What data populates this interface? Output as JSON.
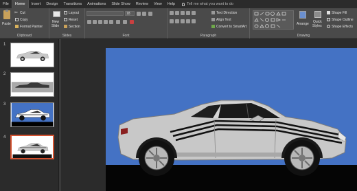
{
  "ribbon_tabs": [
    "File",
    "Home",
    "Insert",
    "Design",
    "Transitions",
    "Animations",
    "Slide Show",
    "Review",
    "View",
    "Help"
  ],
  "active_tab": "Home",
  "tell_me": "Tell me what you want to do",
  "clipboard": {
    "paste": "Paste",
    "cut": "Cut",
    "copy": "Copy",
    "format_painter": "Format Painter",
    "label": "Clipboard"
  },
  "slides_group": {
    "new_slide": "New",
    "new_slide_2": "Slide",
    "layout": "Layout",
    "reset": "Reset",
    "section": "Section",
    "label": "Slides"
  },
  "font_group": {
    "size": "18",
    "label": "Font"
  },
  "paragraph_group": {
    "text_direction": "Text Direction",
    "align_text": "Align Text",
    "convert_smartart": "Convert to SmartArt",
    "label": "Paragraph"
  },
  "drawing_group": {
    "arrange": "Arrange",
    "quick_styles": "Quick",
    "quick_styles_2": "Styles",
    "shape_fill": "Shape Fill",
    "shape_outline": "Shape Outline",
    "shape_effects": "Shape Effects",
    "label": "Drawing"
  },
  "slides": [
    {
      "number": "1"
    },
    {
      "number": "2"
    },
    {
      "number": "3"
    },
    {
      "number": "4",
      "selected": true
    }
  ],
  "colors": {
    "slide_bg": "#4472c4",
    "car_body": "#c8c8c8",
    "stripe": "#111111",
    "accent": "#d35230"
  }
}
